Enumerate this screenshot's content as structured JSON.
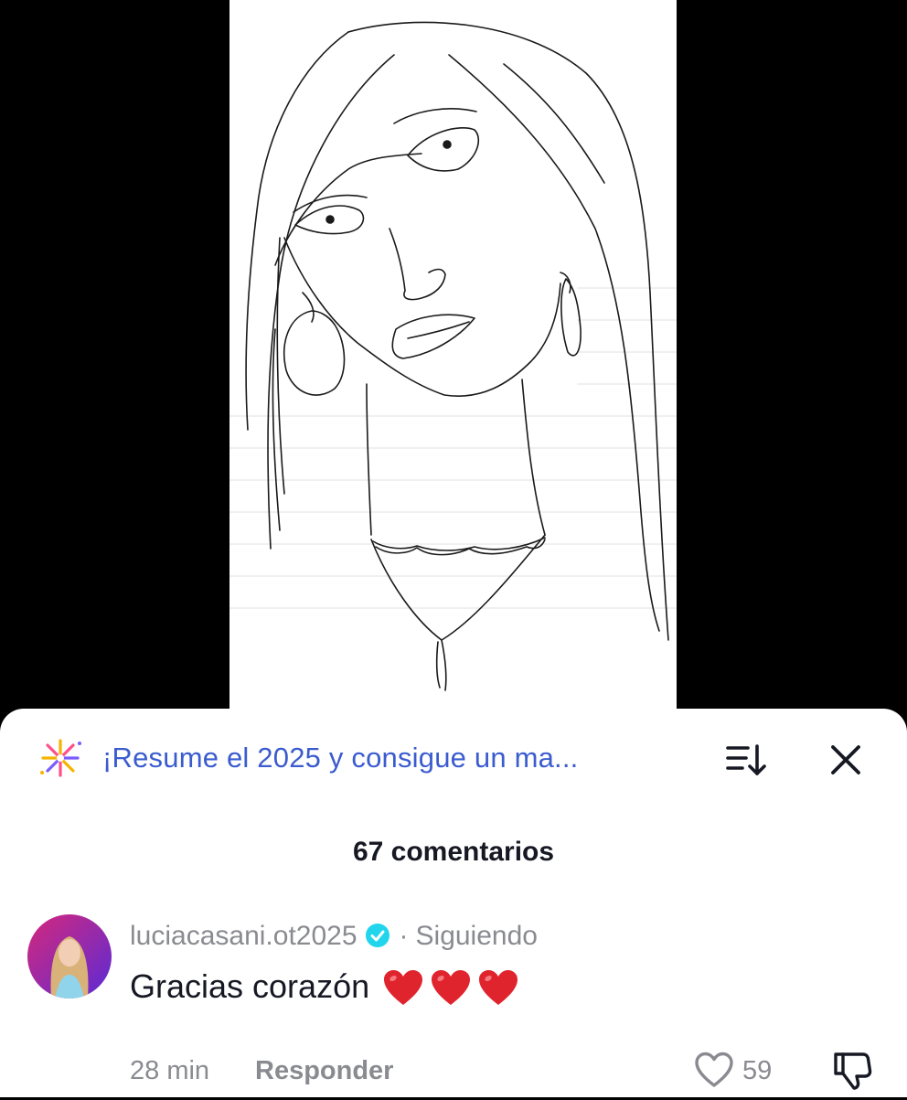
{
  "banner": {
    "text": "¡Resume el 2025 y consigue un ma...",
    "icon": "sparkle-fireworks-icon"
  },
  "header": {
    "comment_count": "67 comentarios",
    "sort_icon": "sort-descending-icon",
    "close_icon": "close-icon"
  },
  "comments": [
    {
      "username": "luciacasani.ot2025",
      "verified": true,
      "separator": "·",
      "relation": "Siguiendo",
      "text": "Gracias corazón",
      "emoji": "❤️❤️❤️",
      "time": "28 min",
      "reply_label": "Responder",
      "likes": "59"
    }
  ],
  "colors": {
    "banner_link": "#3b5ccf",
    "verified_badge": "#20d5ec",
    "heart_emoji": "#e0242d"
  }
}
